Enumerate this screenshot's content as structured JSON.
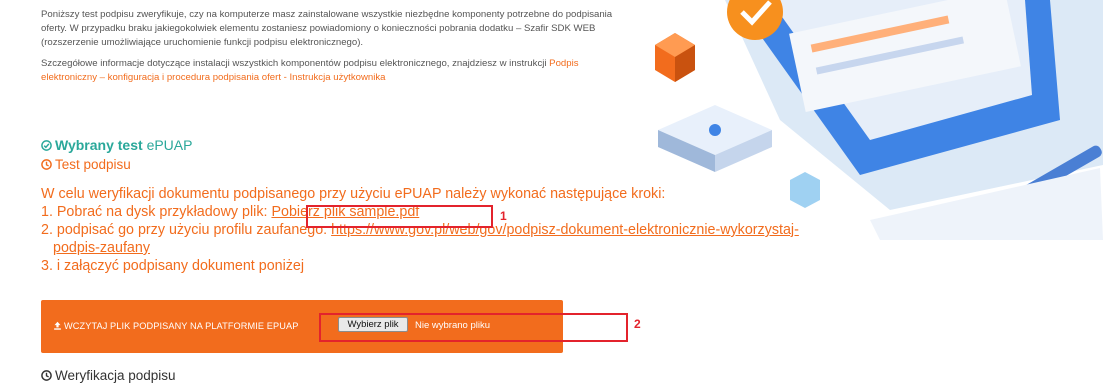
{
  "intro": {
    "p1": "Poniższy test podpisu zweryfikuje, czy na komputerze masz zainstalowane wszystkie niezbędne komponenty potrzebne do podpisania oferty. W przypadku braku jakiegokolwiek elementu zostaniesz powiadomiony o konieczności pobrania dodatku – Szafir SDK WEB (rozszerzenie umożliwiające uruchomienie funkcji podpisu elektronicznego).",
    "p2_before": "Szczegółowe informacje dotyczące instalacji wszystkich komponentów podpisu elektronicznego, znajdziesz w instrukcji ",
    "p2_link": "Podpis elektroniczny – konfiguracja i procedura podpisania ofert - Instrukcja użytkownika"
  },
  "selected_test": {
    "label": "Wybrany test",
    "value": "ePUAP"
  },
  "test_heading": "Test podpisu",
  "steps": {
    "intro": "W celu weryfikacji dokumentu podpisanego przy użyciu ePUAP należy wykonać następujące kroki:",
    "s1_text": "1. Pobrać na dysk przykładowy plik: ",
    "s1_link": "Pobierz plik sample.pdf",
    "s2_text": "2. podpisać go przy użyciu profilu zaufanego: ",
    "s2_link_a": "https://www.gov.pl/web/gov/podpisz-dokument-elektronicznie-wykorzystaj-",
    "s2_link_b": "podpis-zaufany",
    "s3_text": "3. i załączyć podpisany dokument poniżej"
  },
  "upload": {
    "label": "WCZYTAJ PLIK PODPISANY NA PLATFORMIE EPUAP",
    "choose_button": "Wybierz plik",
    "no_file": "Nie wybrano pliku"
  },
  "annotations": {
    "one": "1",
    "two": "2"
  },
  "verification_heading": "Weryfikacja podpisu",
  "colors": {
    "accent": "#f26c1d",
    "teal": "#2aa89a",
    "annotation_red": "#e3232c"
  },
  "icons": [
    "check-circle-icon",
    "clock-icon",
    "upload-icon"
  ]
}
